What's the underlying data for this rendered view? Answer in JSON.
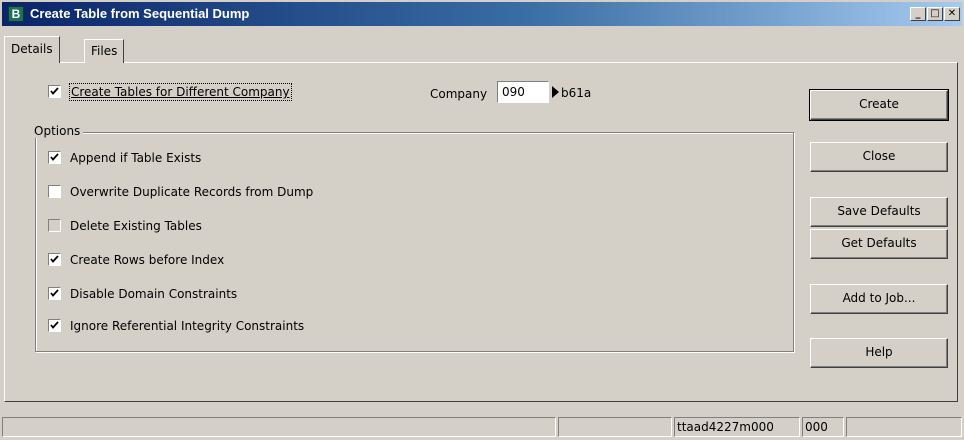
{
  "window": {
    "title": "Create Table from Sequential Dump",
    "icon": "baan-app-icon",
    "controls": {
      "minimize": "_",
      "maximize": "□",
      "close": "✕"
    }
  },
  "tabs": [
    {
      "label": "Details",
      "active": true
    },
    {
      "label": "Files",
      "active": false
    }
  ],
  "main": {
    "different_company": {
      "label": "Create Tables for Different Company",
      "checked": true
    },
    "company": {
      "label": "Company",
      "value": "090",
      "name": "b61a"
    }
  },
  "options": {
    "title": "Options",
    "items": [
      {
        "label": "Append if Table Exists",
        "checked": true,
        "enabled": true
      },
      {
        "label": "Overwrite Duplicate Records from Dump",
        "checked": false,
        "enabled": true
      },
      {
        "label": "Delete Existing Tables",
        "checked": false,
        "enabled": false
      },
      {
        "label": "Create Rows before Index",
        "checked": true,
        "enabled": true
      },
      {
        "label": "Disable Domain Constraints",
        "checked": true,
        "enabled": true
      },
      {
        "label": "Ignore Referential Integrity Constraints",
        "checked": true,
        "enabled": true
      }
    ]
  },
  "buttons": {
    "create": "Create",
    "close": "Close",
    "save_defaults": "Save Defaults",
    "get_defaults": "Get Defaults",
    "add_to_job": "Add to Job...",
    "help": "Help"
  },
  "statusbar": {
    "cells": [
      "",
      "",
      "ttaad4227m000",
      "000",
      ""
    ]
  },
  "colors": {
    "titlebar_start": "#0a246a",
    "titlebar_end": "#a6caf0",
    "face": "#d4d0c8"
  }
}
